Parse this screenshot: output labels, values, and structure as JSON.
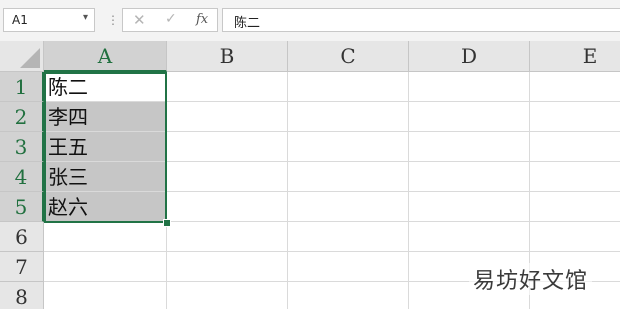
{
  "formula_bar": {
    "name_box": "A1",
    "name_box_arrow": "▾",
    "separator": "⋮",
    "cancel_symbol": "✕",
    "enter_symbol": "✓",
    "fx_label": "fx",
    "formula": "陈二"
  },
  "columns": [
    "A",
    "B",
    "C",
    "D",
    "E"
  ],
  "rows": [
    "1",
    "2",
    "3",
    "4",
    "5",
    "6",
    "7",
    "8"
  ],
  "cells": {
    "A1": "陈二",
    "A2": "李四",
    "A3": "王五",
    "A4": "张三",
    "A5": "赵六"
  },
  "selection": {
    "range": "A1:A5",
    "active_cell": "A1"
  },
  "watermark": "易坊好文馆",
  "colors": {
    "accent_green": "#217346",
    "header_bg": "#e6e6e6",
    "selected_bg": "#c6c6c6"
  }
}
